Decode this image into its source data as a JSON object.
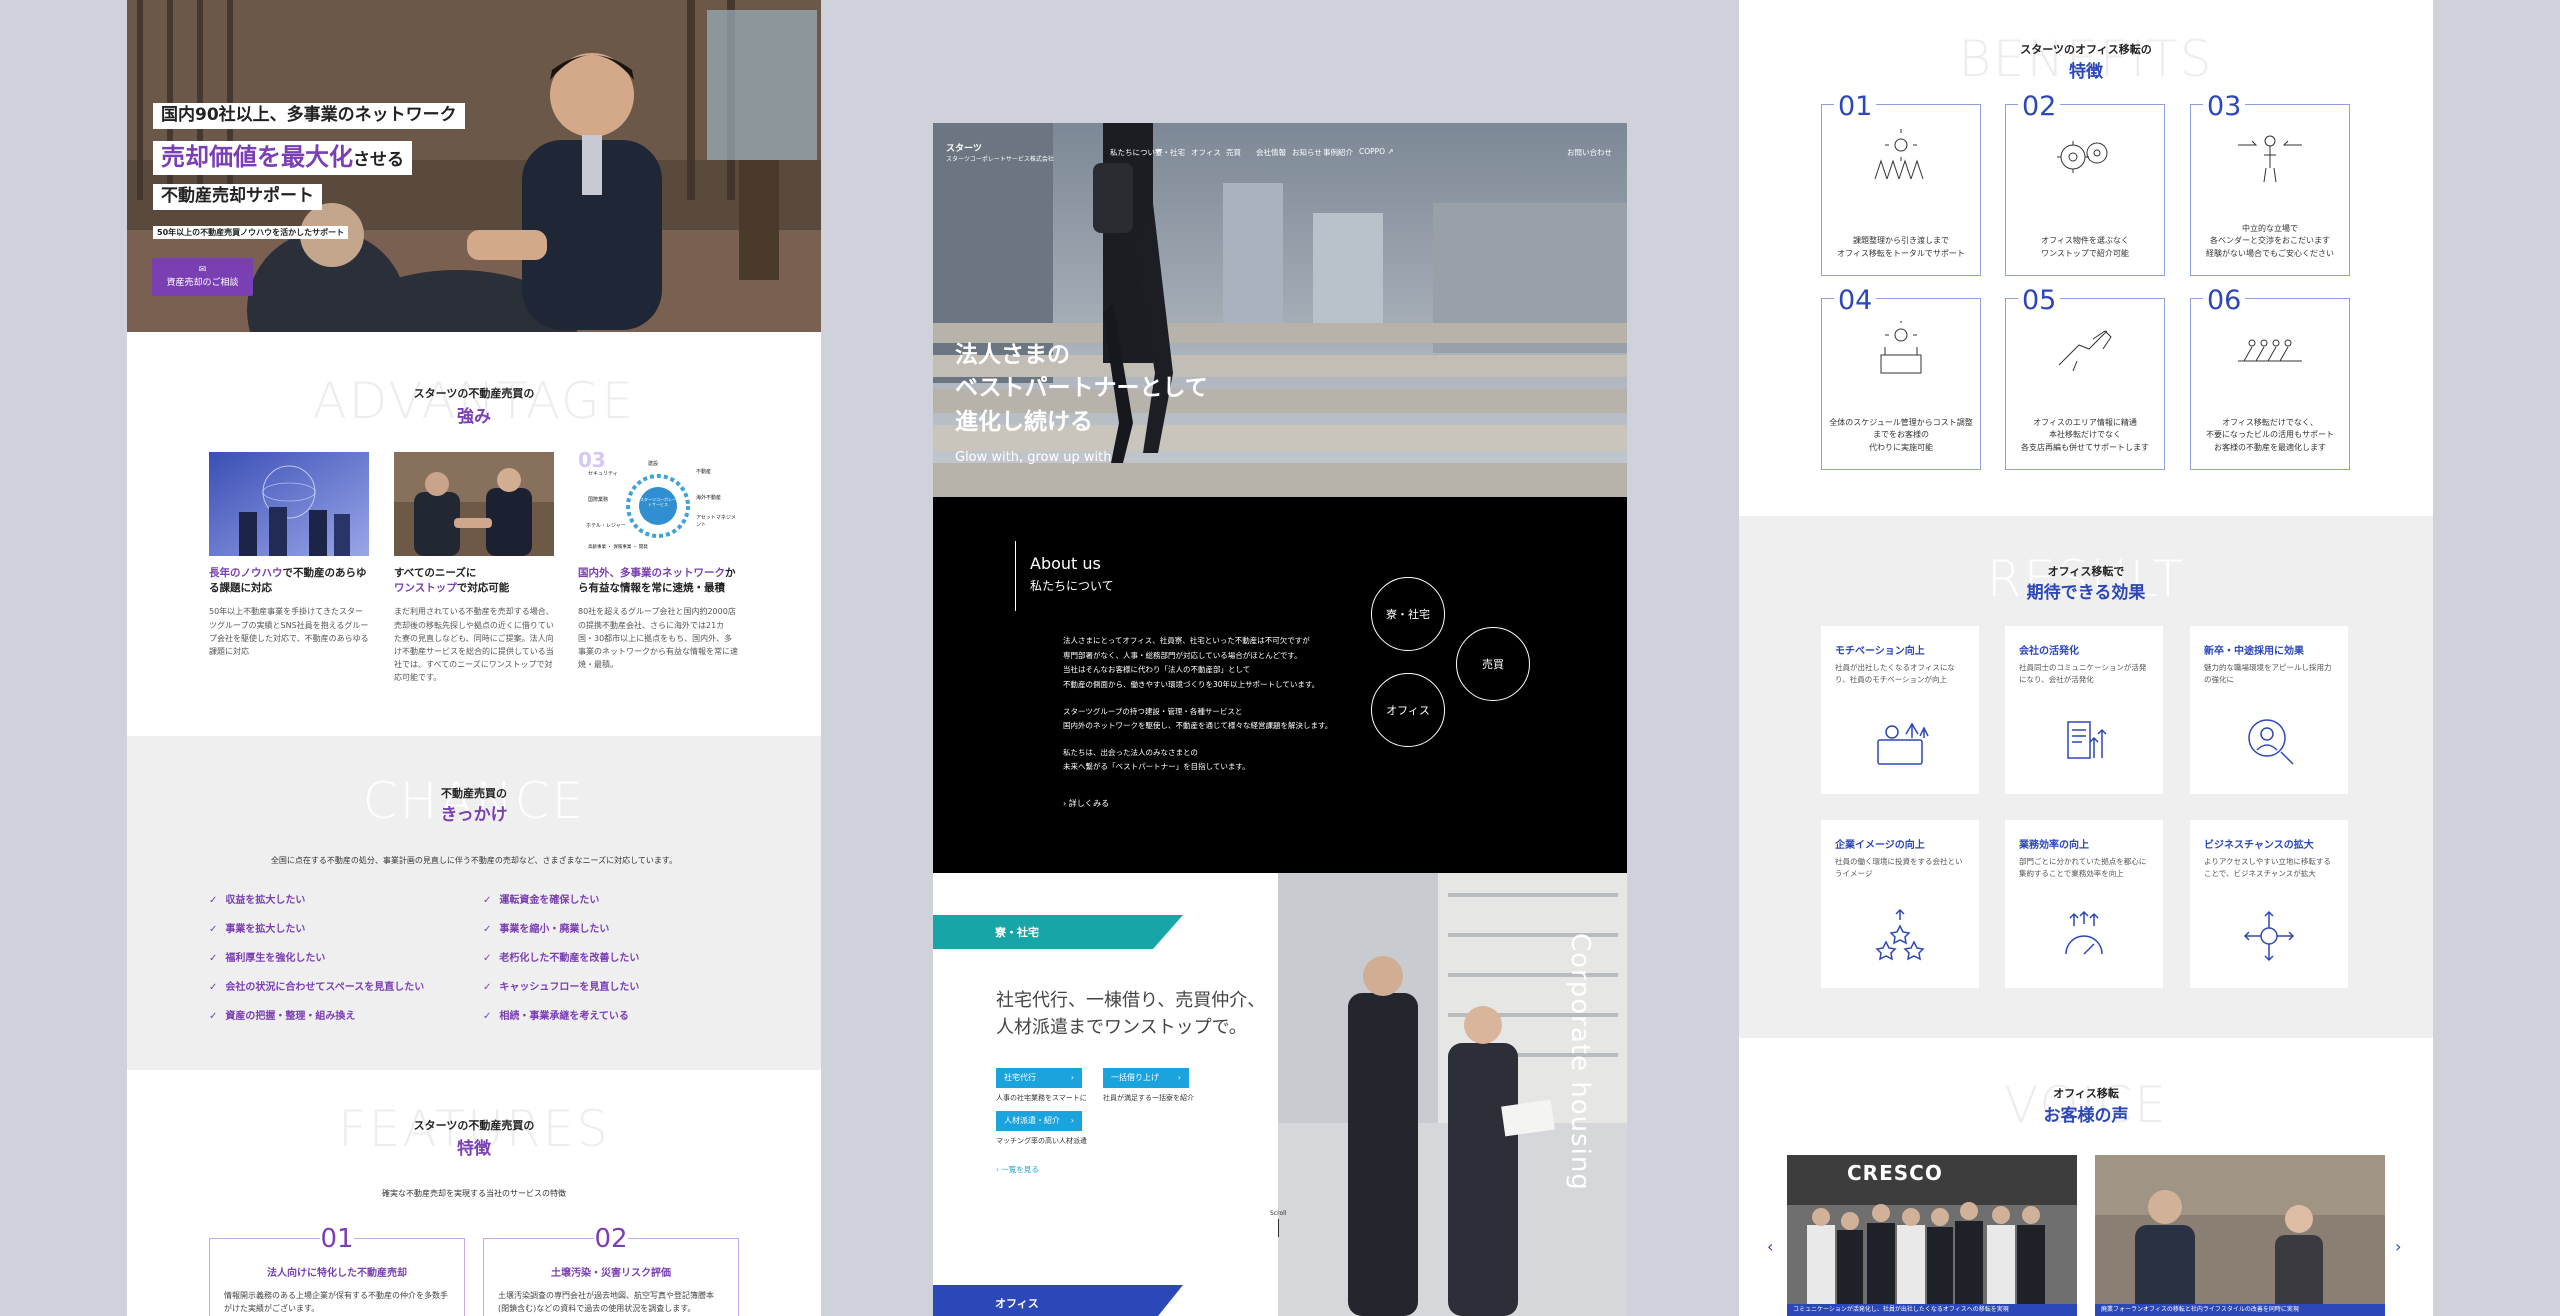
{
  "left_page": {
    "hero": {
      "line1": "国内90社以上、多事業のネットワーク",
      "line2_highlight": "売却価値を最大化",
      "line2_suffix": "させる",
      "line3": "不動産売却サポート",
      "caption": "50年以上の不動産売買ノウハウを活かしたサポート",
      "button": "資産売却のご相談"
    },
    "advantage": {
      "ghost": "ADVANTAGE",
      "sub": "スターツの不動産売買の",
      "title": "強み",
      "cards": [
        {
          "title_highlight": "長年のノウハウ",
          "title_rest": "で不動産のあらゆる課題に対応",
          "desc": "50年以上不動産事業を手掛けてきたスターツグループの実績とSNS社員を抱えるグループ会社を駆使した対応で、不動産のあらゆる課題に対応"
        },
        {
          "title_pre": "すべてのニーズに",
          "title_highlight": "ワンストップ",
          "title_rest": "で対応可能",
          "desc": "まだ利用されている不動産を売却する場合、売却後の移転先探しや拠点の近くに借りていた寮の見直しなども、同時にご提案。法人向け不動産サービスを総合的に提供している当社では、すべてのニーズにワンストップで対応可能です。"
        },
        {
          "title_highlight": "国内外、多事業のネットワーク",
          "title_rest": "から有益な情報を常に速焼・最積",
          "desc": "80社を超えるグループ会社と国内約2000店の提携不動産会社、さらに海外では21カ国・30都市以上に拠点をもち、国内外、多事業のネットワークから有益な情報を常に速焼・最積。"
        }
      ],
      "card3_num": "03",
      "diagram_center": "スターツコーポレートサービス",
      "diagram_labels": [
        "建設",
        "不動産",
        "海外不動産",
        "物件管理",
        "アセットマネジメント",
        "出版・広告・事業",
        "高齢事業 ・ 保険事業 ・ 開発",
        "ホテル・レジャー",
        "国際業務",
        "セキュリティ"
      ]
    },
    "chance": {
      "ghost": "CHANCE",
      "sub": "不動産売買の",
      "title": "きっかけ",
      "lead": "全国に点在する不動産の処分、事業計画の見直しに伴う不動産の売却など、さまざまなニーズに対応しています。",
      "items_left": [
        "収益を拡大したい",
        "事業を拡大したい",
        "福利厚生を強化したい",
        "会社の状況に合わせてスペースを見直したい",
        "資産の把握・整理・組み換え"
      ],
      "items_right": [
        "運転資金を確保したい",
        "事業を縮小・廃業したい",
        "老朽化した不動産を改善したい",
        "キャッシュフローを見直したい",
        "相続・事業承継を考えている"
      ]
    },
    "features": {
      "ghost": "FEATURES",
      "sub": "スターツの不動産売買の",
      "title": "特徴",
      "lead": "確実な不動産売却を実現する当社のサービスの特徴",
      "cards": [
        {
          "num": "01",
          "title": "法人向けに特化した不動産売却",
          "desc": "情報開示義務のある上場企業が保有する不動産の仲介を多数手がけた実績がございます。"
        },
        {
          "num": "02",
          "title": "土壌汚染・災害リスク評価",
          "desc": "土壌汚染調査の専門会社が過去地図、航空写真や登記簿謄本(閉鎖含む)などの資料で過去の使用状況を調査します。"
        }
      ]
    }
  },
  "center_page": {
    "brand_top": "スターツ",
    "brand_bottom": "スターツコーポレートサービス株式会社",
    "nav": [
      "私たちについて",
      "寮・社宅",
      "オフィス",
      "売買",
      "会社情報",
      "お知らせ",
      "事例紹介",
      "COPPO ↗"
    ],
    "contact": "お問い合わせ",
    "hero": {
      "line1": "法人さまの",
      "line2": "ベストパートナーとして",
      "line3": "進化し続ける",
      "tagline": "Glow with, grow up with"
    },
    "about": {
      "en": "About us",
      "ja": "私たちについて",
      "para1": [
        "法人さまにとってオフィス、社員寮、社宅といった不動産は不可欠ですが",
        "専門部署がなく、人事・総務部門が対応している場合がほとんどです。",
        "当社はそんなお客様に代わり「法人の不動産部」として",
        "不動産の側面から、働きやすい環境づくりを30年以上サポートしています。"
      ],
      "para2": [
        "スターツグループの持つ建設・管理・各種サービスと",
        "国内外のネットワークを駆使し、不動産を通じて様々な経営課題を解決します。"
      ],
      "para3": [
        "私たちは、出会った法人のみなさまとの",
        "未来へ繋がる「ベストパートナー」を目指しています。"
      ],
      "more": "詳しくみる",
      "circles": [
        "寮・社宅",
        "売買",
        "オフィス"
      ]
    },
    "housing": {
      "tag": "寮・社宅",
      "heading1": "社宅代行、一棟借り、売買仲介、",
      "heading2": "人材派遣までワンストップで。",
      "pills": [
        {
          "label": "社宅代行",
          "note": "人事の社宅業務をスマートに"
        },
        {
          "label": "一括借り上げ",
          "note": "社員が満足する一括寮を紹介"
        },
        {
          "label": "人材派遣・紹介",
          "note": "マッチング率の高い人材派遣"
        }
      ],
      "list_link": "一覧を見る",
      "scroll": "Scroll",
      "vertical": "Corporate housing"
    },
    "office_tag": "オフィス"
  },
  "right_page": {
    "benefits": {
      "ghost": "BENEFITS",
      "sub": "スターツのオフィス移転の",
      "title": "特徴",
      "cards": [
        {
          "num": "01",
          "lines": [
            "課題整理から引き渡しまで",
            "オフィス移転をトータルでサポート"
          ]
        },
        {
          "num": "02",
          "lines": [
            "オフィス物件を選ぶなく",
            "ワンストップで紹介可能"
          ]
        },
        {
          "num": "03",
          "lines": [
            "中立的な立場で",
            "各ベンダーと交渉をおこだいます",
            "経験がない場合でもご安心ください"
          ]
        },
        {
          "num": "04",
          "lines": [
            "全体のスケジュール管理からコスト調整までをお客様の",
            "代わりに実施可能"
          ]
        },
        {
          "num": "05",
          "lines": [
            "オフィスのエリア情報に精通",
            "本社移転だけでなく",
            "各支店再編も併せてサポートします"
          ]
        },
        {
          "num": "06",
          "lines": [
            "オフィス移転だけでなく、",
            "不要になったビルの活用もサポート",
            "お客様の不動産を最適化します"
          ]
        }
      ]
    },
    "result": {
      "ghost": "RESULT",
      "sub": "オフィス移転で",
      "title": "期待できる効果",
      "cards": [
        {
          "title": "モチベーション向上",
          "desc": "社員が出社したくなるオフィスになり、社員のモチベーションが向上"
        },
        {
          "title": "会社の活発化",
          "desc": "社員同士のコミュニケーションが活発になり、会社が活発化"
        },
        {
          "title": "新卒・中途採用に効果",
          "desc": "魅力的な職場環境をアピールし採用力の強化に"
        },
        {
          "title": "企業イメージの向上",
          "desc": "社員の働く環境に投資をする会社というイメージ"
        },
        {
          "title": "業務効率の向上",
          "desc": "部門ごとに分かれていた拠点を都心に集約することで業務効率を向上"
        },
        {
          "title": "ビジネスチャンスの拡大",
          "desc": "よりアクセスしやすい立地に移転することで、ビジネスチャンスが拡大"
        }
      ]
    },
    "voice": {
      "ghost": "VOICE",
      "sub": "オフィス移転",
      "title": "お客様の声",
      "sign": "CRESCO",
      "caption1": "コミュニケーションが活発化し、社員が出社したくなるオフィスへの移転を実現",
      "caption2": "廃業フォーランオフィスの移転と社内ライフスタイルの改善を同時に実現"
    }
  },
  "colors": {
    "purple": "#7a3fb3",
    "navy": "#2c47b8",
    "teal": "#17a5a8",
    "sky": "#1aa3dc",
    "background": "#cfd2da"
  }
}
